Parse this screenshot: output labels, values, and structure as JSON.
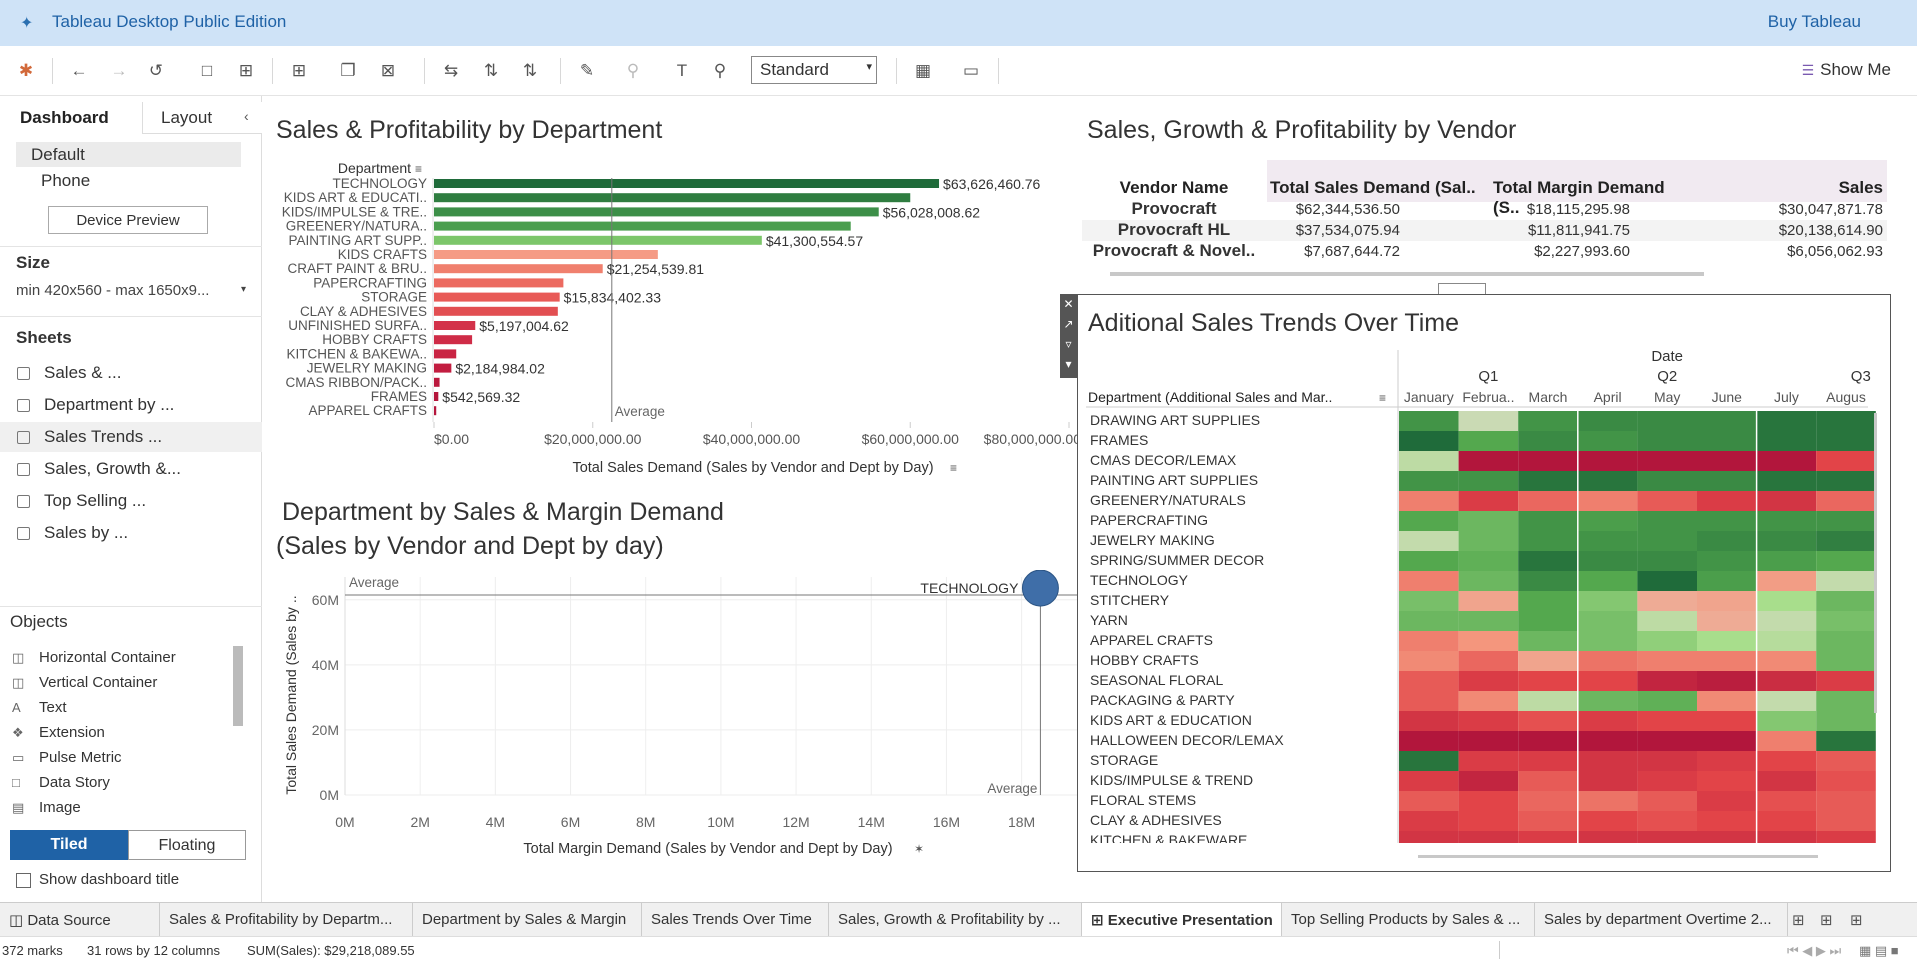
{
  "app": {
    "title": "Tableau Desktop Public Edition",
    "buy_label": "Buy Tableau"
  },
  "toolbar": {
    "fit_value": "Standard",
    "show_me_label": "Show Me"
  },
  "left_pane": {
    "tabs": [
      "Dashboard",
      "Layout"
    ],
    "devices": [
      "Default",
      "Phone"
    ],
    "device_preview_label": "Device Preview",
    "size_heading": "Size",
    "size_value": "min 420x560 - max 1650x9...",
    "sheets_heading": "Sheets",
    "sheets": [
      "Sales & ...",
      "Department by ...",
      "Sales Trends ...",
      "Sales, Growth &...",
      "Top Selling ...",
      "Sales by ..."
    ],
    "objects_heading": "Objects",
    "objects": [
      "Horizontal Container",
      "Vertical Container",
      "Text",
      "Extension",
      "Pulse Metric",
      "Data Story",
      "Image"
    ],
    "tiled_label": "Tiled",
    "floating_label": "Floating",
    "show_title_label": "Show dashboard title"
  },
  "dashboard": {
    "bar_title": "Sales & Profitability by Department",
    "scatter_title_1": "Department by Sales & Margin Demand",
    "scatter_title_2": "(Sales by Vendor and Dept by day)",
    "vendor_title": "Sales, Growth & Profitability by Vendor",
    "heat_title": "Aditional Sales Trends Over Time"
  },
  "colors": {
    "dark_green": "#1f6b3a",
    "green": "#4a9e4e",
    "light_green": "#8fd07a",
    "salmon": "#f08a78",
    "red": "#e0454a",
    "dark_red": "#b5163c",
    "accent": "#1f62a6"
  },
  "chart_data": [
    {
      "type": "bar",
      "title": "Sales & Profitability by Department",
      "ylabel": "Department",
      "xlabel": "Total Sales Demand (Sales by Vendor and Dept by Day)",
      "xlim": [
        0,
        80000000
      ],
      "x_ticks": [
        "$0.00",
        "$20,000,000.00",
        "$40,000,000.00",
        "$60,000,000.00",
        "$80,000,000.00"
      ],
      "reference_line": {
        "label": "Average",
        "value": 22400000
      },
      "categories": [
        "TECHNOLOGY",
        "KIDS ART & EDUCATI..",
        "KIDS/IMPULSE & TRE..",
        "GREENERY/NATURA..",
        "PAINTING ART SUPP..",
        "KIDS CRAFTS",
        "CRAFT PAINT & BRU..",
        "PAPERCRAFTING",
        "STORAGE",
        "CLAY & ADHESIVES",
        "UNFINISHED SURFA..",
        "HOBBY CRAFTS",
        "KITCHEN & BAKEWA..",
        "JEWELRY MAKING",
        "CMAS RIBBON/PACK..",
        "FRAMES",
        "APPAREL CRAFTS"
      ],
      "values": [
        63626460.76,
        60000000,
        56028008.62,
        52500000,
        41300554.57,
        28200000,
        21254539.81,
        16300000,
        15834402.33,
        15600000,
        5197004.62,
        4800000,
        2800000,
        2184984.02,
        700000,
        542569.32,
        280000
      ],
      "labels": [
        "$63,626,460.76",
        "",
        "$56,028,008.62",
        "",
        "$41,300,554.57",
        "",
        "$21,254,539.81",
        "",
        "$15,834,402.33",
        "",
        "$5,197,004.62",
        "",
        "",
        "$2,184,984.02",
        "",
        "$542,569.32",
        ""
      ],
      "colors": [
        "#1f6b3a",
        "#2f7d40",
        "#3c8f48",
        "#4a9e4e",
        "#7cc66a",
        "#f59b85",
        "#f0806e",
        "#ec6a60",
        "#e85a57",
        "#e24f52",
        "#d3324a",
        "#cf2c47",
        "#c92443",
        "#c21d40",
        "#bb183d",
        "#b5163c",
        "#b5163c"
      ]
    },
    {
      "type": "scatter",
      "title": "Department by Sales & Margin Demand (Sales by Vendor and Dept by day)",
      "xlabel": "Total Margin Demand (Sales by Vendor and Dept by Day)",
      "ylabel": "Total Sales Demand (Sales by ..",
      "x_ticks": [
        "0M",
        "2M",
        "4M",
        "6M",
        "8M",
        "10M",
        "12M",
        "14M",
        "16M",
        "18M"
      ],
      "y_ticks": [
        "0M",
        "20M",
        "40M",
        "60M"
      ],
      "xlim": [
        0,
        19500000
      ],
      "ylim": [
        0,
        67000000
      ],
      "reference_lines": [
        "Average",
        "Average"
      ],
      "points": [
        {
          "label": "TECHNOLOGY",
          "x": 18500000,
          "y": 63600000
        }
      ]
    },
    {
      "type": "table",
      "title": "Sales, Growth & Profitability by Vendor",
      "columns": [
        "Vendor Name",
        "Total Sales Demand (Sal..",
        "Total Margin Demand (S..",
        "Sales"
      ],
      "rows": [
        [
          "Provocraft",
          "$62,344,536.50",
          "$18,115,295.98",
          "$30,047,871.78"
        ],
        [
          "Provocraft HL",
          "$37,534,075.94",
          "$11,811,941.75",
          "$20,138,614.90"
        ],
        [
          "Provocraft & Novel..",
          "$7,687,644.72",
          "$2,227,993.60",
          "$6,056,062.93"
        ]
      ]
    },
    {
      "type": "heatmap",
      "title": "Aditional Sales Trends Over Time",
      "row_header": "Department (Additional Sales and Mar..",
      "column_group": "Date",
      "quarters": [
        "Q1",
        "Q2",
        "Q3"
      ],
      "months": [
        "January",
        "Februa..",
        "March",
        "April",
        "May",
        "June",
        "July",
        "Augus"
      ],
      "rows": [
        "DRAWING ART SUPPLIES",
        "FRAMES",
        "CMAS DECOR/LEMAX",
        "PAINTING ART SUPPLIES",
        "GREENERY/NATURALS",
        "PAPERCRAFTING",
        "JEWELRY MAKING",
        "SPRING/SUMMER DECOR",
        "TECHNOLOGY",
        "STITCHERY",
        "YARN",
        "APPAREL CRAFTS",
        "HOBBY CRAFTS",
        "SEASONAL FLORAL",
        "PACKAGING & PARTY",
        "KIDS ART & EDUCATION",
        "HALLOWEEN DECOR/LEMAX",
        "STORAGE",
        "KIDS/IMPULSE & TREND",
        "FLORAL STEMS",
        "CLAY & ADHESIVES",
        "KITCHEN & BAKEWARE"
      ],
      "values": [
        [
          0.8,
          0.1,
          0.8,
          0.85,
          0.85,
          0.85,
          0.95,
          0.95
        ],
        [
          1.0,
          0.7,
          0.85,
          0.8,
          0.85,
          0.85,
          0.95,
          0.95
        ],
        [
          0.2,
          -1.0,
          -1.0,
          -1.0,
          -1.0,
          -1.0,
          -1.0,
          -0.7
        ],
        [
          0.8,
          0.8,
          0.95,
          0.95,
          0.85,
          0.85,
          0.95,
          0.95
        ],
        [
          -0.45,
          -0.75,
          -0.55,
          -0.45,
          -0.6,
          -0.75,
          -0.8,
          -0.55
        ],
        [
          0.7,
          0.6,
          0.8,
          0.75,
          0.8,
          0.8,
          0.8,
          0.8
        ],
        [
          0.15,
          0.6,
          0.8,
          0.8,
          0.8,
          0.85,
          0.85,
          0.9
        ],
        [
          0.7,
          0.65,
          0.95,
          0.85,
          0.85,
          0.8,
          0.75,
          0.7
        ],
        [
          -0.45,
          0.6,
          0.85,
          0.7,
          1.0,
          0.75,
          -0.3,
          0.15
        ],
        [
          0.55,
          -0.25,
          0.7,
          0.5,
          -0.2,
          -0.25,
          0.35,
          0.6
        ],
        [
          0.6,
          0.6,
          0.7,
          0.55,
          0.2,
          -0.2,
          0.15,
          0.55
        ],
        [
          -0.45,
          -0.35,
          0.6,
          0.55,
          0.45,
          0.35,
          0.25,
          0.6
        ],
        [
          -0.4,
          -0.55,
          -0.25,
          -0.5,
          -0.45,
          -0.45,
          -0.4,
          0.6
        ],
        [
          -0.6,
          -0.75,
          -0.7,
          -0.7,
          -0.9,
          -0.95,
          -0.85,
          -0.75
        ],
        [
          -0.6,
          -0.4,
          0.2,
          0.6,
          0.65,
          -0.4,
          0.15,
          0.6
        ],
        [
          -0.8,
          -0.75,
          -0.65,
          -0.75,
          -0.7,
          -0.7,
          0.5,
          0.6
        ],
        [
          -1.0,
          -1.0,
          -1.0,
          -1.0,
          -1.0,
          -1.0,
          -0.45,
          0.95
        ],
        [
          0.95,
          -0.75,
          -0.75,
          -0.8,
          -0.8,
          -0.75,
          -0.7,
          -0.6
        ],
        [
          -0.75,
          -0.9,
          -0.6,
          -0.8,
          -0.75,
          -0.7,
          -0.8,
          -0.65
        ],
        [
          -0.6,
          -0.7,
          -0.55,
          -0.5,
          -0.6,
          -0.75,
          -0.65,
          -0.6
        ],
        [
          -0.75,
          -0.7,
          -0.6,
          -0.7,
          -0.65,
          -0.7,
          -0.7,
          -0.6
        ],
        [
          -0.8,
          -0.8,
          -0.75,
          -0.8,
          -0.8,
          -0.8,
          -0.8,
          -0.75
        ]
      ]
    }
  ],
  "sheet_tabs": [
    "Data Source",
    "Sales & Profitability by Departm...",
    "Department by Sales & Margin",
    "Sales Trends Over Time",
    "Sales, Growth & Profitability by ...",
    "Executive Presentation",
    "Top Selling Products by Sales & ...",
    "Sales by department Overtime 2..."
  ],
  "status": {
    "marks": "372 marks",
    "rows_cols": "31 rows by 12 columns",
    "sum": "SUM(Sales): $29,218,089.55"
  }
}
